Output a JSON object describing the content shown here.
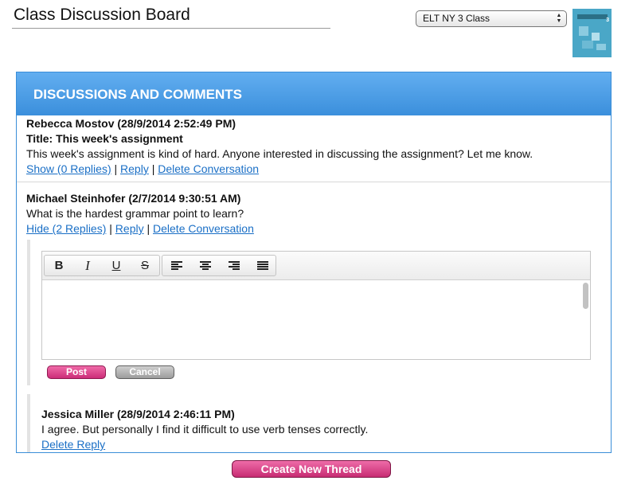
{
  "page": {
    "title": "Class Discussion Board",
    "class_select": "ELT NY 3 Class",
    "book_cover_label": "3"
  },
  "panel": {
    "header": "DISCUSSIONS AND COMMENTS"
  },
  "threads": [
    {
      "author_line": "Rebecca Mostov (28/9/2014 2:52:49 PM)",
      "title_line": "Title: This week's assignment",
      "body": "This week's assignment is kind of hard. Anyone interested in discussing the assignment? Let me know.",
      "toggle_link": "Show (0 Replies)",
      "reply_link": "Reply",
      "delete_link": "Delete Conversation"
    },
    {
      "author_line": "Michael Steinhofer (2/7/2014 9:30:51 AM)",
      "body": "What is the hardest grammar point to learn?",
      "toggle_link": "Hide (2 Replies)",
      "reply_link": "Reply",
      "delete_link": "Delete Conversation"
    }
  ],
  "separator": "|",
  "editor": {
    "toolbar": {
      "bold": "B",
      "italic": "I",
      "underline": "U",
      "strikethrough": "S",
      "align_icons": [
        "align-left-icon",
        "align-center-icon",
        "align-right-icon",
        "align-justify-icon"
      ]
    },
    "post_label": "Post",
    "cancel_label": "Cancel"
  },
  "reply": {
    "author_line": "Jessica Miller (28/9/2014 2:46:11 PM)",
    "body": "I agree. But personally I find it difficult to use verb tenses correctly.",
    "delete_link": "Delete Reply"
  },
  "footer": {
    "create_label": "Create New Thread"
  },
  "colors": {
    "header_blue": "#3b8fdc",
    "link_blue": "#1a6fc6",
    "post_pink": "#cc2d78"
  }
}
